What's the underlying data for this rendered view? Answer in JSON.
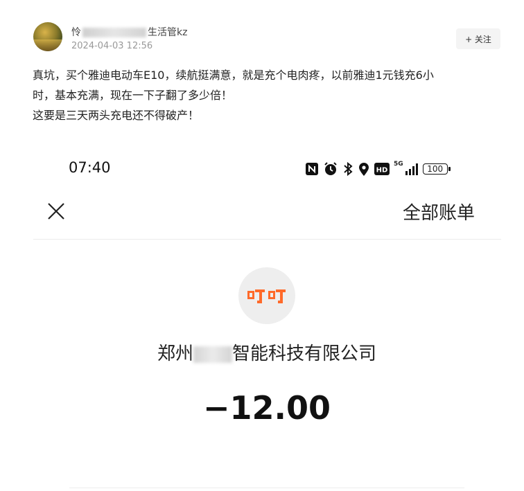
{
  "post": {
    "username_prefix": "怜",
    "username_suffix": "生活管kz",
    "timestamp": "2024-04-03 12:56",
    "follow_label": "+ 关注",
    "text_lines": [
      "真坑，买个雅迪电动车E10，续航挺满意，就是充个电肉疼，以前雅迪1元钱充6小",
      "时，基本充满，现在一下子翻了多少倍！",
      "这要是三天两头充电还不得破产！"
    ]
  },
  "screenshot": {
    "status_bar": {
      "time": "07:40",
      "network": "5G",
      "battery": "100",
      "icons": [
        "nfc-icon",
        "alarm-icon",
        "bluetooth-icon",
        "location-icon",
        "hd-icon",
        "signal-icon",
        "battery-icon"
      ]
    },
    "header": {
      "title": "全部账单"
    },
    "merchant": {
      "logo_text": "叮叮",
      "name_prefix": "郑州",
      "name_suffix": "智能科技有限公司"
    },
    "amount": "−12.00",
    "colors": {
      "logo_orange": "#ff6a2a",
      "logo_bg": "#eeeeee"
    }
  }
}
